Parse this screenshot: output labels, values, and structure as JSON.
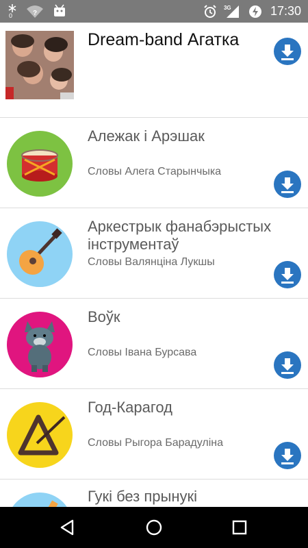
{
  "status_bar": {
    "time": "17:30",
    "network_type": "3G",
    "icons": [
      "snowflake-icon",
      "wifi-question-icon",
      "android-icon",
      "alarm-icon",
      "signal-icon",
      "data-saver-icon",
      "battery-icon"
    ]
  },
  "header": {
    "title": "Dream-band Агатка"
  },
  "songs": [
    {
      "title": "Алежак і Арэшак",
      "subtitle": "Словы Алега Старынчыка",
      "icon": "drum-icon",
      "color": "#7dc242"
    },
    {
      "title": "Аркестрык фанабэрыстых інструментаў",
      "subtitle": "Словы Валянціна Лукшы",
      "icon": "mandolin-icon",
      "color": "#8fd3f5"
    },
    {
      "title": "Воўк",
      "subtitle": "Словы Івана Бурсава",
      "icon": "wolf-icon",
      "color": "#e0157f"
    },
    {
      "title": "Год-Карагод",
      "subtitle": "Словы Рыгора Барадуліна",
      "icon": "triangle-instrument-icon",
      "color": "#f7d51c"
    },
    {
      "title": "Гукі без прынукі",
      "subtitle": "",
      "icon": "instrument-icon",
      "color": "#8fd3f5"
    }
  ],
  "colors": {
    "accent": "#2a75c0",
    "status_bar": "#7a7a7a",
    "nav_bar": "#000000"
  },
  "nav": {
    "icons": [
      "back-icon",
      "home-icon",
      "recents-icon"
    ]
  }
}
